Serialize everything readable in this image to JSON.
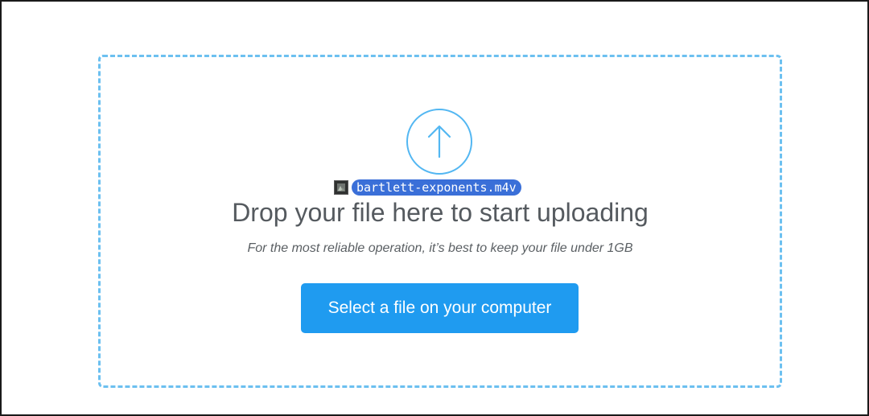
{
  "dropzone": {
    "dragged_file_name": "bartlett-exponents.m4v",
    "headline": "Drop your file here to start uploading",
    "subtext": "For the most reliable operation, it’s best to keep your file under 1GB",
    "select_button_label": "Select a file on your computer"
  },
  "icons": {
    "upload": "arrow-up-icon",
    "dragged_file": "video-file-icon"
  },
  "colors": {
    "dashed_border": "#6cc0f0",
    "accent": "#1f9bf0",
    "file_chip": "#3a6fd8",
    "headline_text": "#555a5f"
  }
}
